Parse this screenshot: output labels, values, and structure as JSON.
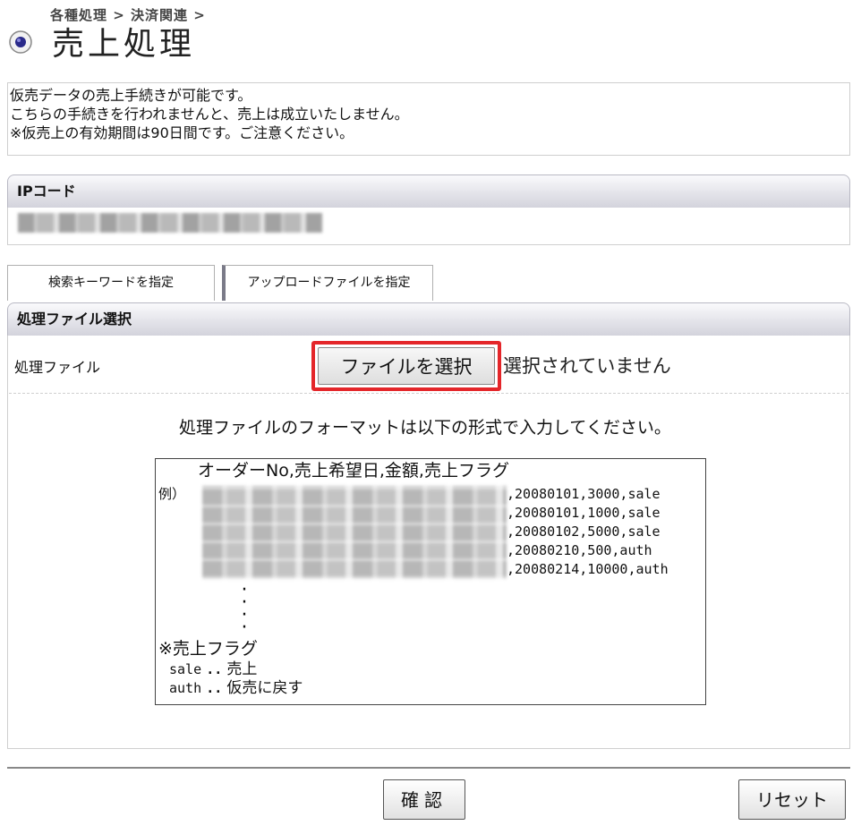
{
  "header": {
    "breadcrumb": "各種処理 > 決済関連 >",
    "title": "売上処理"
  },
  "info": {
    "lines": [
      "仮売データの売上手続きが可能です。",
      "こちらの手続きを行われませんと、売上は成立いたしません。",
      "※仮売上の有効期間は90日間です。ご注意ください。"
    ]
  },
  "ip_section": {
    "title": "IPコード"
  },
  "tabs": [
    {
      "label": "検索キーワードを指定"
    },
    {
      "label": "アップロードファイルを指定"
    }
  ],
  "file_section": {
    "title": "処理ファイル選択",
    "file_label": "処理ファイル",
    "choose_button": "ファイルを選択",
    "status": "選択されていません",
    "format_instruction": "処理ファイルのフォーマットは以下の形式で入力してください。",
    "example": {
      "header": "オーダーNo,売上希望日,金額,売上フラグ",
      "prefix": "例）",
      "rows": [
        ",20080101,3000,sale",
        ",20080101,1000,sale",
        ",20080102,5000,sale",
        ",20080210,500,auth",
        ",20080214,10000,auth"
      ],
      "flag_title": "※売上フラグ",
      "flags": [
        {
          "code": "sale",
          "sep": "..",
          "meaning": "売上"
        },
        {
          "code": "auth",
          "sep": "..",
          "meaning": "仮売に戻す"
        }
      ]
    }
  },
  "buttons": {
    "confirm": "確認",
    "reset": "リセット"
  },
  "colors": {
    "highlight_border": "#e4262a",
    "section_bar_border": "#b9b9c4"
  }
}
